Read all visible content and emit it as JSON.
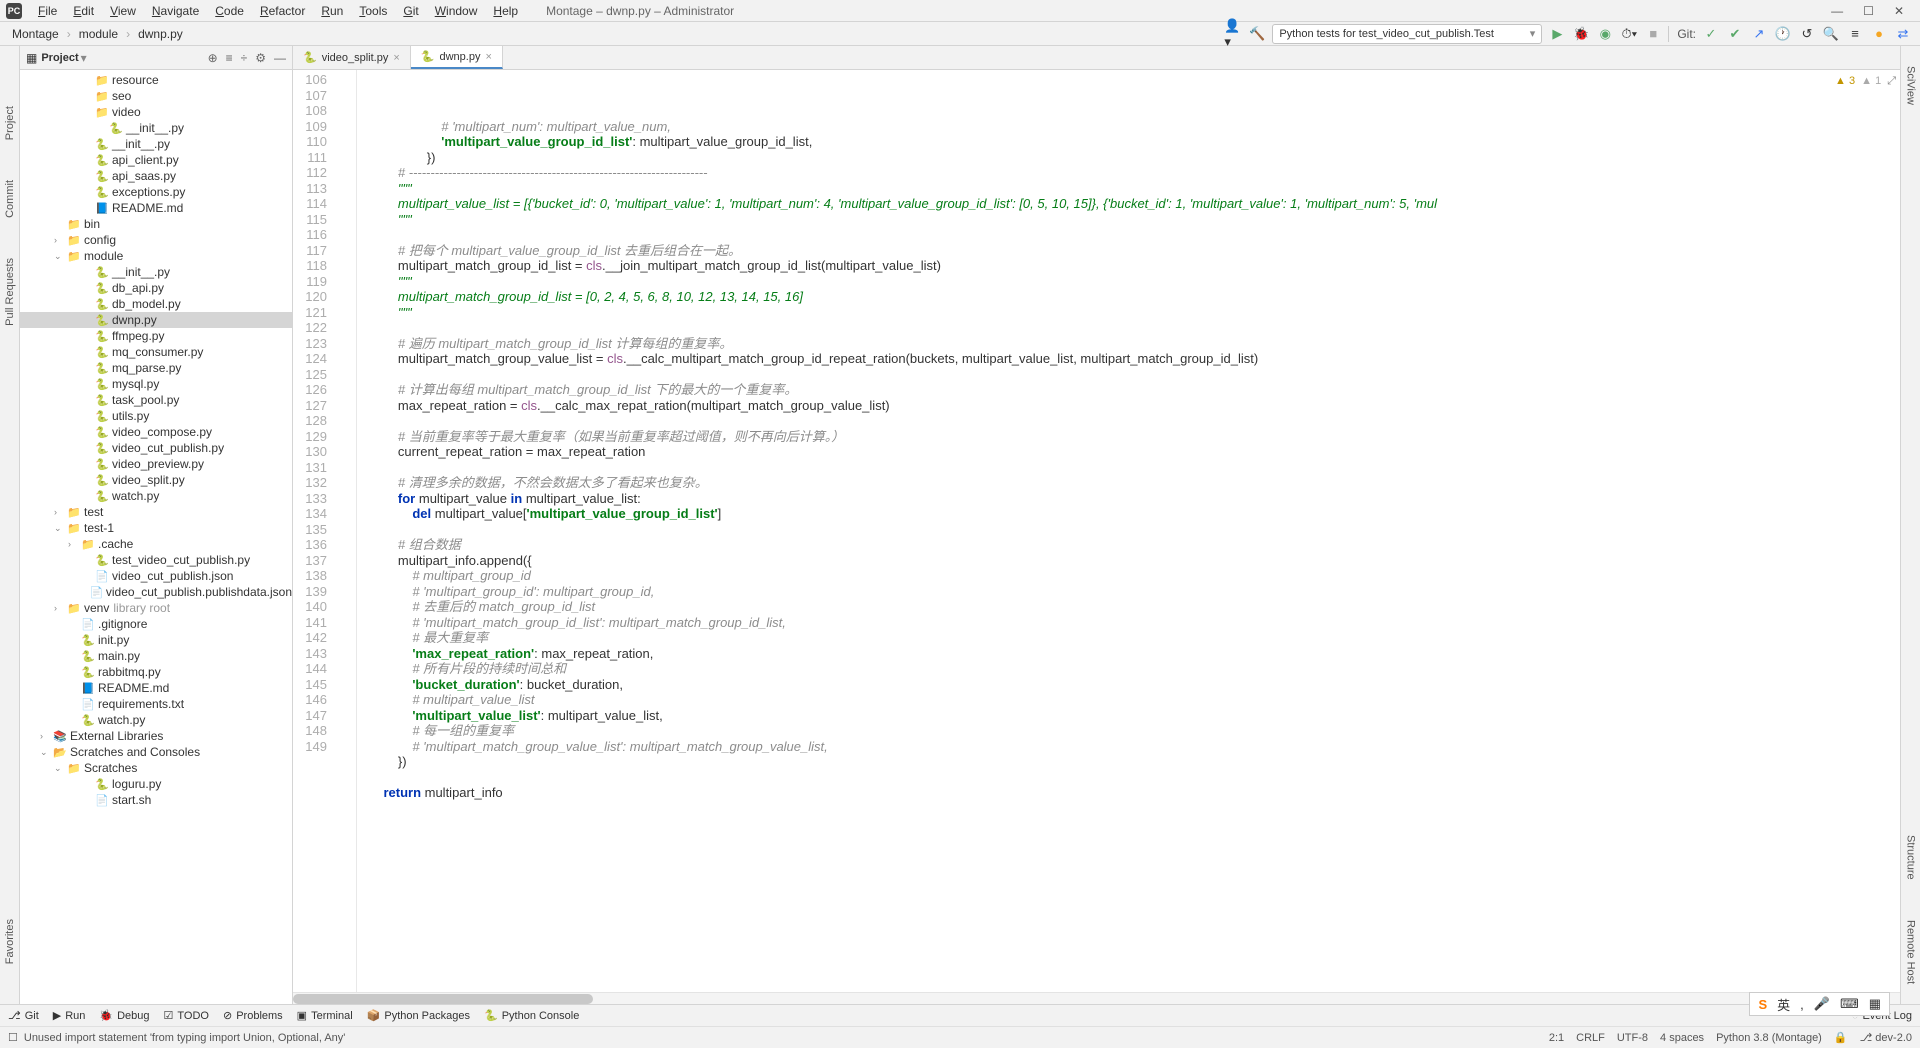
{
  "window_title": "Montage – dwnp.py – Administrator",
  "menus": [
    "File",
    "Edit",
    "View",
    "Navigate",
    "Code",
    "Refactor",
    "Run",
    "Tools",
    "Git",
    "Window",
    "Help"
  ],
  "breadcrumbs": [
    "Montage",
    "module",
    "dwnp.py"
  ],
  "run_config": "Python tests for test_video_cut_publish.Test",
  "git_label": "Git:",
  "project_panel_title": "Project",
  "tabs": [
    {
      "label": "video_split.py",
      "active": false
    },
    {
      "label": "dwnp.py",
      "active": true
    }
  ],
  "left_rail": [
    "Project",
    "Commit",
    "Pull Requests",
    "Favorites"
  ],
  "right_rail": [
    "SciView",
    "Structure",
    "Remote Host"
  ],
  "bottom_tools": [
    "Git",
    "Run",
    "Debug",
    "TODO",
    "Problems",
    "Terminal",
    "Python Packages",
    "Python Console"
  ],
  "event_log": "Event Log",
  "status_msg": "Unused import statement 'from typing import Union, Optional, Any'",
  "status_right": [
    "2:1",
    "CRLF",
    "UTF-8",
    "4 spaces",
    "Python 3.8 (Montage)",
    "",
    "dev-2.0"
  ],
  "warnings": {
    "yellow": "3",
    "weak": "1"
  },
  "ime": {
    "brand": "S",
    "lang": "英"
  },
  "tree": [
    {
      "indent": 4,
      "chev": "",
      "icon": "📁",
      "label": "resource",
      "cls": ""
    },
    {
      "indent": 4,
      "chev": "",
      "icon": "📁",
      "label": "seo",
      "cls": ""
    },
    {
      "indent": 4,
      "chev": "",
      "icon": "📁",
      "label": "video",
      "cls": ""
    },
    {
      "indent": 5,
      "chev": "",
      "icon": "🐍",
      "label": "__init__.py",
      "cls": ""
    },
    {
      "indent": 4,
      "chev": "",
      "icon": "🐍",
      "label": "__init__.py",
      "cls": ""
    },
    {
      "indent": 4,
      "chev": "",
      "icon": "🐍",
      "label": "api_client.py",
      "cls": ""
    },
    {
      "indent": 4,
      "chev": "",
      "icon": "🐍",
      "label": "api_saas.py",
      "cls": ""
    },
    {
      "indent": 4,
      "chev": "",
      "icon": "🐍",
      "label": "exceptions.py",
      "cls": ""
    },
    {
      "indent": 4,
      "chev": "",
      "icon": "📘",
      "label": "README.md",
      "cls": ""
    },
    {
      "indent": 2,
      "chev": "",
      "icon": "📁",
      "label": "bin",
      "cls": ""
    },
    {
      "indent": 2,
      "chev": "›",
      "icon": "📁",
      "label": "config",
      "cls": ""
    },
    {
      "indent": 2,
      "chev": "⌄",
      "icon": "📁",
      "label": "module",
      "cls": ""
    },
    {
      "indent": 4,
      "chev": "",
      "icon": "🐍",
      "label": "__init__.py",
      "cls": ""
    },
    {
      "indent": 4,
      "chev": "",
      "icon": "🐍",
      "label": "db_api.py",
      "cls": ""
    },
    {
      "indent": 4,
      "chev": "",
      "icon": "🐍",
      "label": "db_model.py",
      "cls": ""
    },
    {
      "indent": 4,
      "chev": "",
      "icon": "🐍",
      "label": "dwnp.py",
      "cls": "selected"
    },
    {
      "indent": 4,
      "chev": "",
      "icon": "🐍",
      "label": "ffmpeg.py",
      "cls": ""
    },
    {
      "indent": 4,
      "chev": "",
      "icon": "🐍",
      "label": "mq_consumer.py",
      "cls": ""
    },
    {
      "indent": 4,
      "chev": "",
      "icon": "🐍",
      "label": "mq_parse.py",
      "cls": ""
    },
    {
      "indent": 4,
      "chev": "",
      "icon": "🐍",
      "label": "mysql.py",
      "cls": ""
    },
    {
      "indent": 4,
      "chev": "",
      "icon": "🐍",
      "label": "task_pool.py",
      "cls": ""
    },
    {
      "indent": 4,
      "chev": "",
      "icon": "🐍",
      "label": "utils.py",
      "cls": ""
    },
    {
      "indent": 4,
      "chev": "",
      "icon": "🐍",
      "label": "video_compose.py",
      "cls": ""
    },
    {
      "indent": 4,
      "chev": "",
      "icon": "🐍",
      "label": "video_cut_publish.py",
      "cls": ""
    },
    {
      "indent": 4,
      "chev": "",
      "icon": "🐍",
      "label": "video_preview.py",
      "cls": ""
    },
    {
      "indent": 4,
      "chev": "",
      "icon": "🐍",
      "label": "video_split.py",
      "cls": ""
    },
    {
      "indent": 4,
      "chev": "",
      "icon": "🐍",
      "label": "watch.py",
      "cls": ""
    },
    {
      "indent": 2,
      "chev": "›",
      "icon": "📁",
      "label": "test",
      "cls": ""
    },
    {
      "indent": 2,
      "chev": "⌄",
      "icon": "📁",
      "label": "test-1",
      "cls": ""
    },
    {
      "indent": 3,
      "chev": "›",
      "icon": "📁",
      "label": ".cache",
      "cls": ""
    },
    {
      "indent": 4,
      "chev": "",
      "icon": "🐍",
      "label": "test_video_cut_publish.py",
      "cls": ""
    },
    {
      "indent": 4,
      "chev": "",
      "icon": "📄",
      "label": "video_cut_publish.json",
      "cls": ""
    },
    {
      "indent": 4,
      "chev": "",
      "icon": "📄",
      "label": "video_cut_publish.publishdata.json",
      "cls": ""
    },
    {
      "indent": 2,
      "chev": "›",
      "icon": "📁",
      "label": "venv",
      "suffix": "library root",
      "cls": ""
    },
    {
      "indent": 3,
      "chev": "",
      "icon": "📄",
      "label": ".gitignore",
      "cls": ""
    },
    {
      "indent": 3,
      "chev": "",
      "icon": "🐍",
      "label": "init.py",
      "cls": ""
    },
    {
      "indent": 3,
      "chev": "",
      "icon": "🐍",
      "label": "main.py",
      "cls": ""
    },
    {
      "indent": 3,
      "chev": "",
      "icon": "🐍",
      "label": "rabbitmq.py",
      "cls": ""
    },
    {
      "indent": 3,
      "chev": "",
      "icon": "📘",
      "label": "README.md",
      "cls": ""
    },
    {
      "indent": 3,
      "chev": "",
      "icon": "📄",
      "label": "requirements.txt",
      "cls": ""
    },
    {
      "indent": 3,
      "chev": "",
      "icon": "🐍",
      "label": "watch.py",
      "cls": ""
    },
    {
      "indent": 1,
      "chev": "›",
      "icon": "📚",
      "label": "External Libraries",
      "cls": ""
    },
    {
      "indent": 1,
      "chev": "⌄",
      "icon": "📂",
      "label": "Scratches and Consoles",
      "cls": ""
    },
    {
      "indent": 2,
      "chev": "⌄",
      "icon": "📁",
      "label": "Scratches",
      "cls": ""
    },
    {
      "indent": 4,
      "chev": "",
      "icon": "🐍",
      "label": "loguru.py",
      "cls": ""
    },
    {
      "indent": 4,
      "chev": "",
      "icon": "📄",
      "label": "start.sh",
      "cls": ""
    }
  ],
  "code_start_line": 106,
  "code_lines": [
    "                    # 'multipart_num': multipart_value_num,",
    "                    'multipart_value_group_id_list': multipart_value_group_id_list,",
    "                })",
    "        # ---------------------------------------------------------------------",
    "        \"\"\"",
    "        multipart_value_list = [{'bucket_id': 0, 'multipart_value': 1, 'multipart_num': 4, 'multipart_value_group_id_list': [0, 5, 10, 15]}, {'bucket_id': 1, 'multipart_value': 1, 'multipart_num': 5, 'mul",
    "        \"\"\"",
    "",
    "        # 把每个 multipart_value_group_id_list 去重后组合在一起。",
    "        multipart_match_group_id_list = cls.__join_multipart_match_group_id_list(multipart_value_list)",
    "        \"\"\"",
    "        multipart_match_group_id_list = [0, 2, 4, 5, 6, 8, 10, 12, 13, 14, 15, 16]",
    "        \"\"\"",
    "",
    "        # 遍历 multipart_match_group_id_list 计算每组的重复率。",
    "        multipart_match_group_value_list = cls.__calc_multipart_match_group_id_repeat_ration(buckets, multipart_value_list, multipart_match_group_id_list)",
    "",
    "        # 计算出每组 multipart_match_group_id_list 下的最大的一个重复率。",
    "        max_repeat_ration = cls.__calc_max_repat_ration(multipart_match_group_value_list)",
    "",
    "        # 当前重复率等于最大重复率（如果当前重复率超过阈值，则不再向后计算。）",
    "        current_repeat_ration = max_repeat_ration",
    "",
    "        # 清理多余的数据，不然会数据太多了看起来也复杂。",
    "        for multipart_value in multipart_value_list:",
    "            del multipart_value['multipart_value_group_id_list']",
    "",
    "        # 组合数据",
    "        multipart_info.append({",
    "            # multipart_group_id",
    "            # 'multipart_group_id': multipart_group_id,",
    "            # 去重后的 match_group_id_list",
    "            # 'multipart_match_group_id_list': multipart_match_group_id_list,",
    "            # 最大重复率",
    "            'max_repeat_ration': max_repeat_ration,",
    "            # 所有片段的持续时间总和",
    "            'bucket_duration': bucket_duration,",
    "            # multipart_value_list",
    "            'multipart_value_list': multipart_value_list,",
    "            # 每一组的重复率",
    "            # 'multipart_match_group_value_list': multipart_match_group_value_list,",
    "        })",
    "",
    "    return multipart_info"
  ]
}
